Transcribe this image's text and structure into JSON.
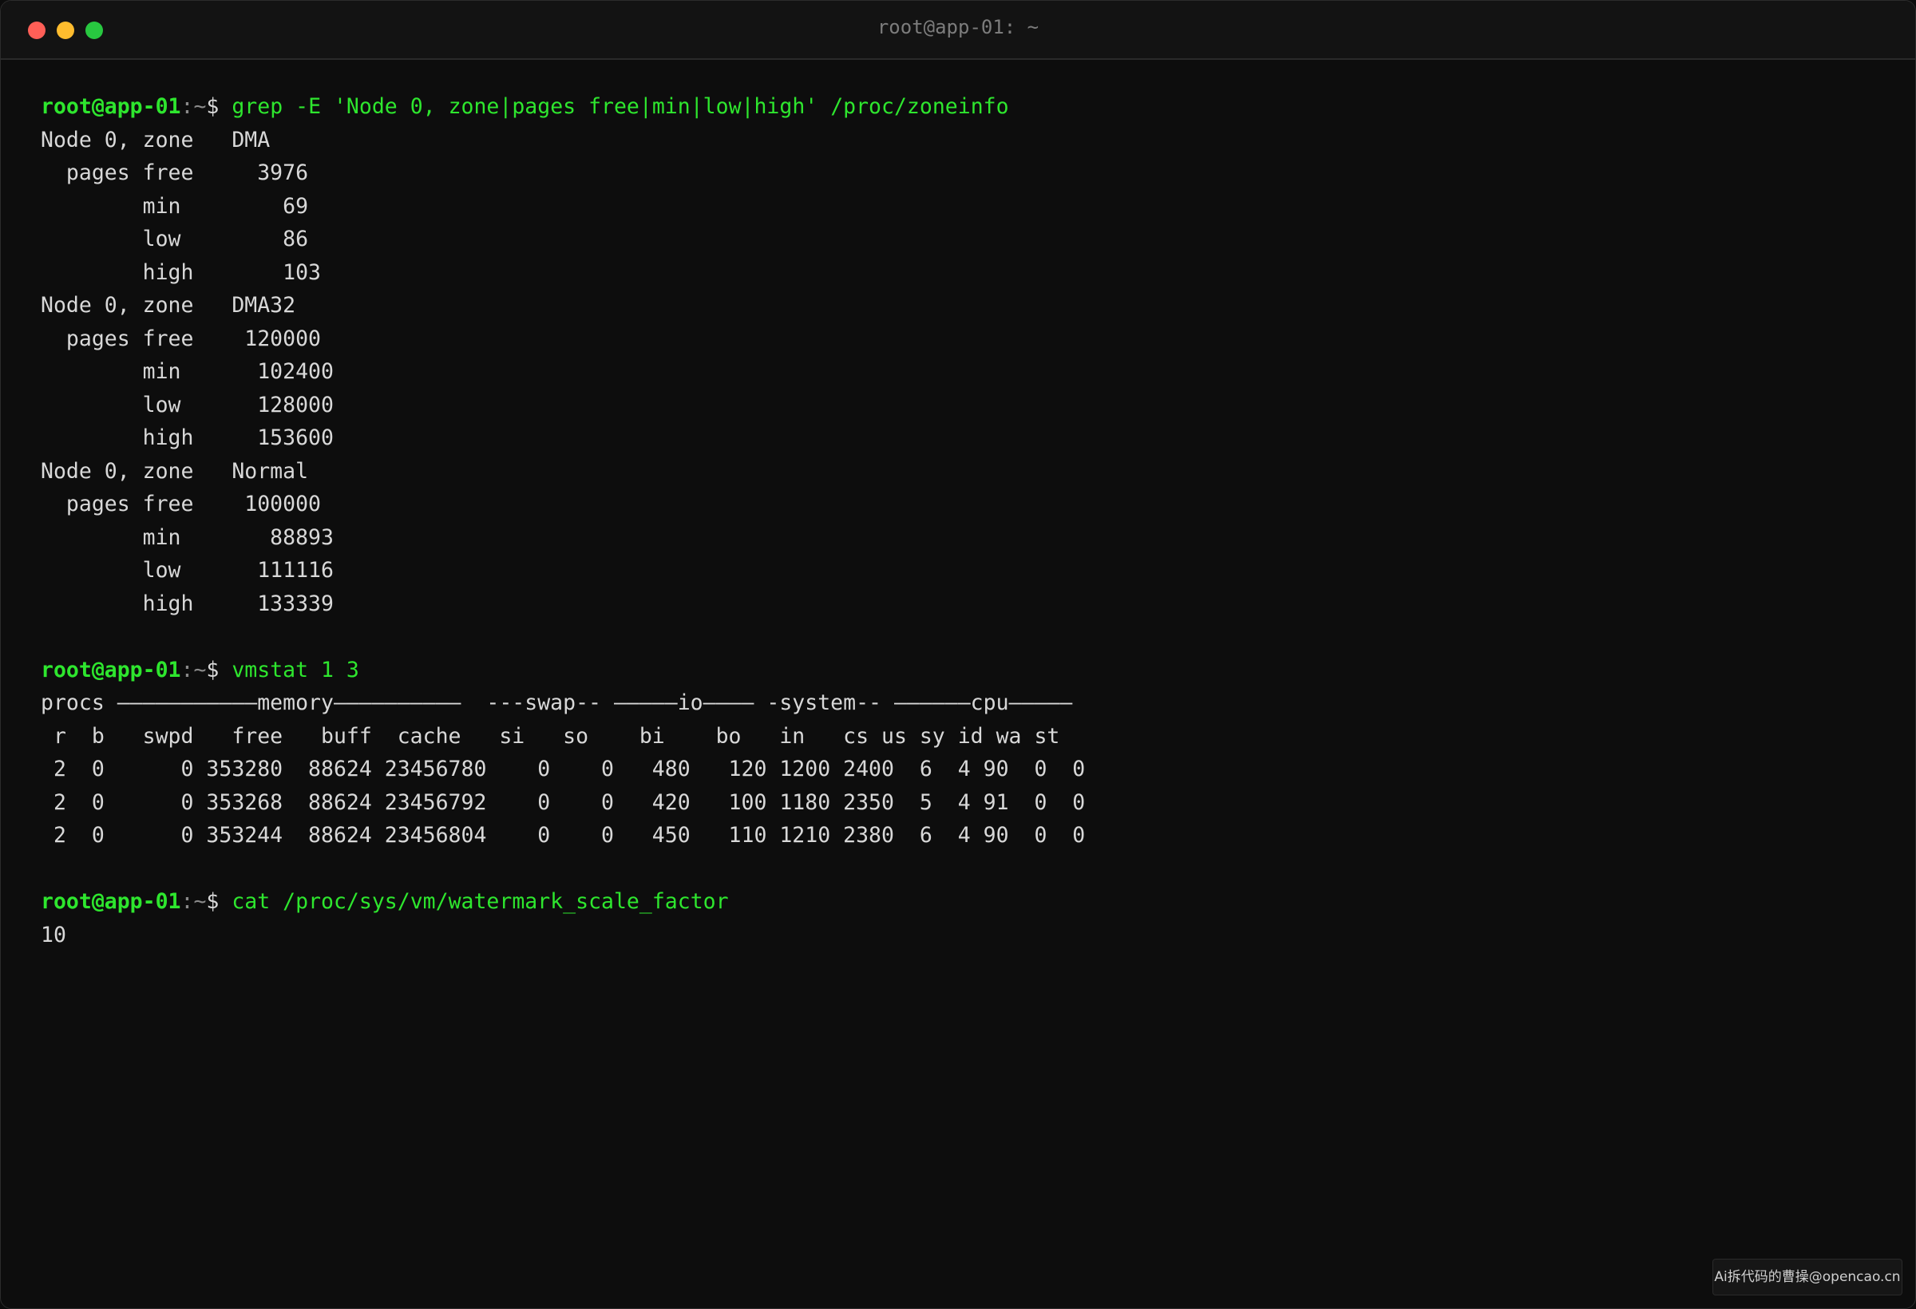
{
  "window": {
    "title": "root@app-01: ~"
  },
  "prompt": {
    "user_host": "root@app-01",
    "path": ":~",
    "symbol": "$ "
  },
  "terminal": {
    "commands": [
      "grep -E 'Node 0, zone|pages free|min|low|high' /proc/zoneinfo",
      "vmstat 1 3",
      "cat /proc/sys/vm/watermark_scale_factor"
    ],
    "zoneinfo_output": [
      "Node 0, zone   DMA",
      "  pages free     3976",
      "        min        69",
      "        low        86",
      "        high       103",
      "Node 0, zone   DMA32",
      "  pages free    120000",
      "        min      102400",
      "        low      128000",
      "        high     153600",
      "Node 0, zone   Normal",
      "  pages free    100000",
      "        min       88893",
      "        low      111116",
      "        high     133339"
    ],
    "vmstat_output": [
      "procs ———————————memory——————————  ---swap-- —————io———— -system-- ——————cpu—————",
      " r  b   swpd   free   buff  cache   si   so    bi    bo   in   cs us sy id wa st",
      " 2  0      0 353280  88624 23456780    0    0   480   120 1200 2400  6  4 90  0  0",
      " 2  0      0 353268  88624 23456792    0    0   420   100 1180 2350  5  4 91  0  0",
      " 2  0      0 353244  88624 23456804    0    0   450   110 1210 2380  6  4 90  0  0"
    ],
    "watermark_output": [
      "10"
    ]
  },
  "watermark": {
    "text": "Ai拆代码的曹操@opencao.cn"
  }
}
